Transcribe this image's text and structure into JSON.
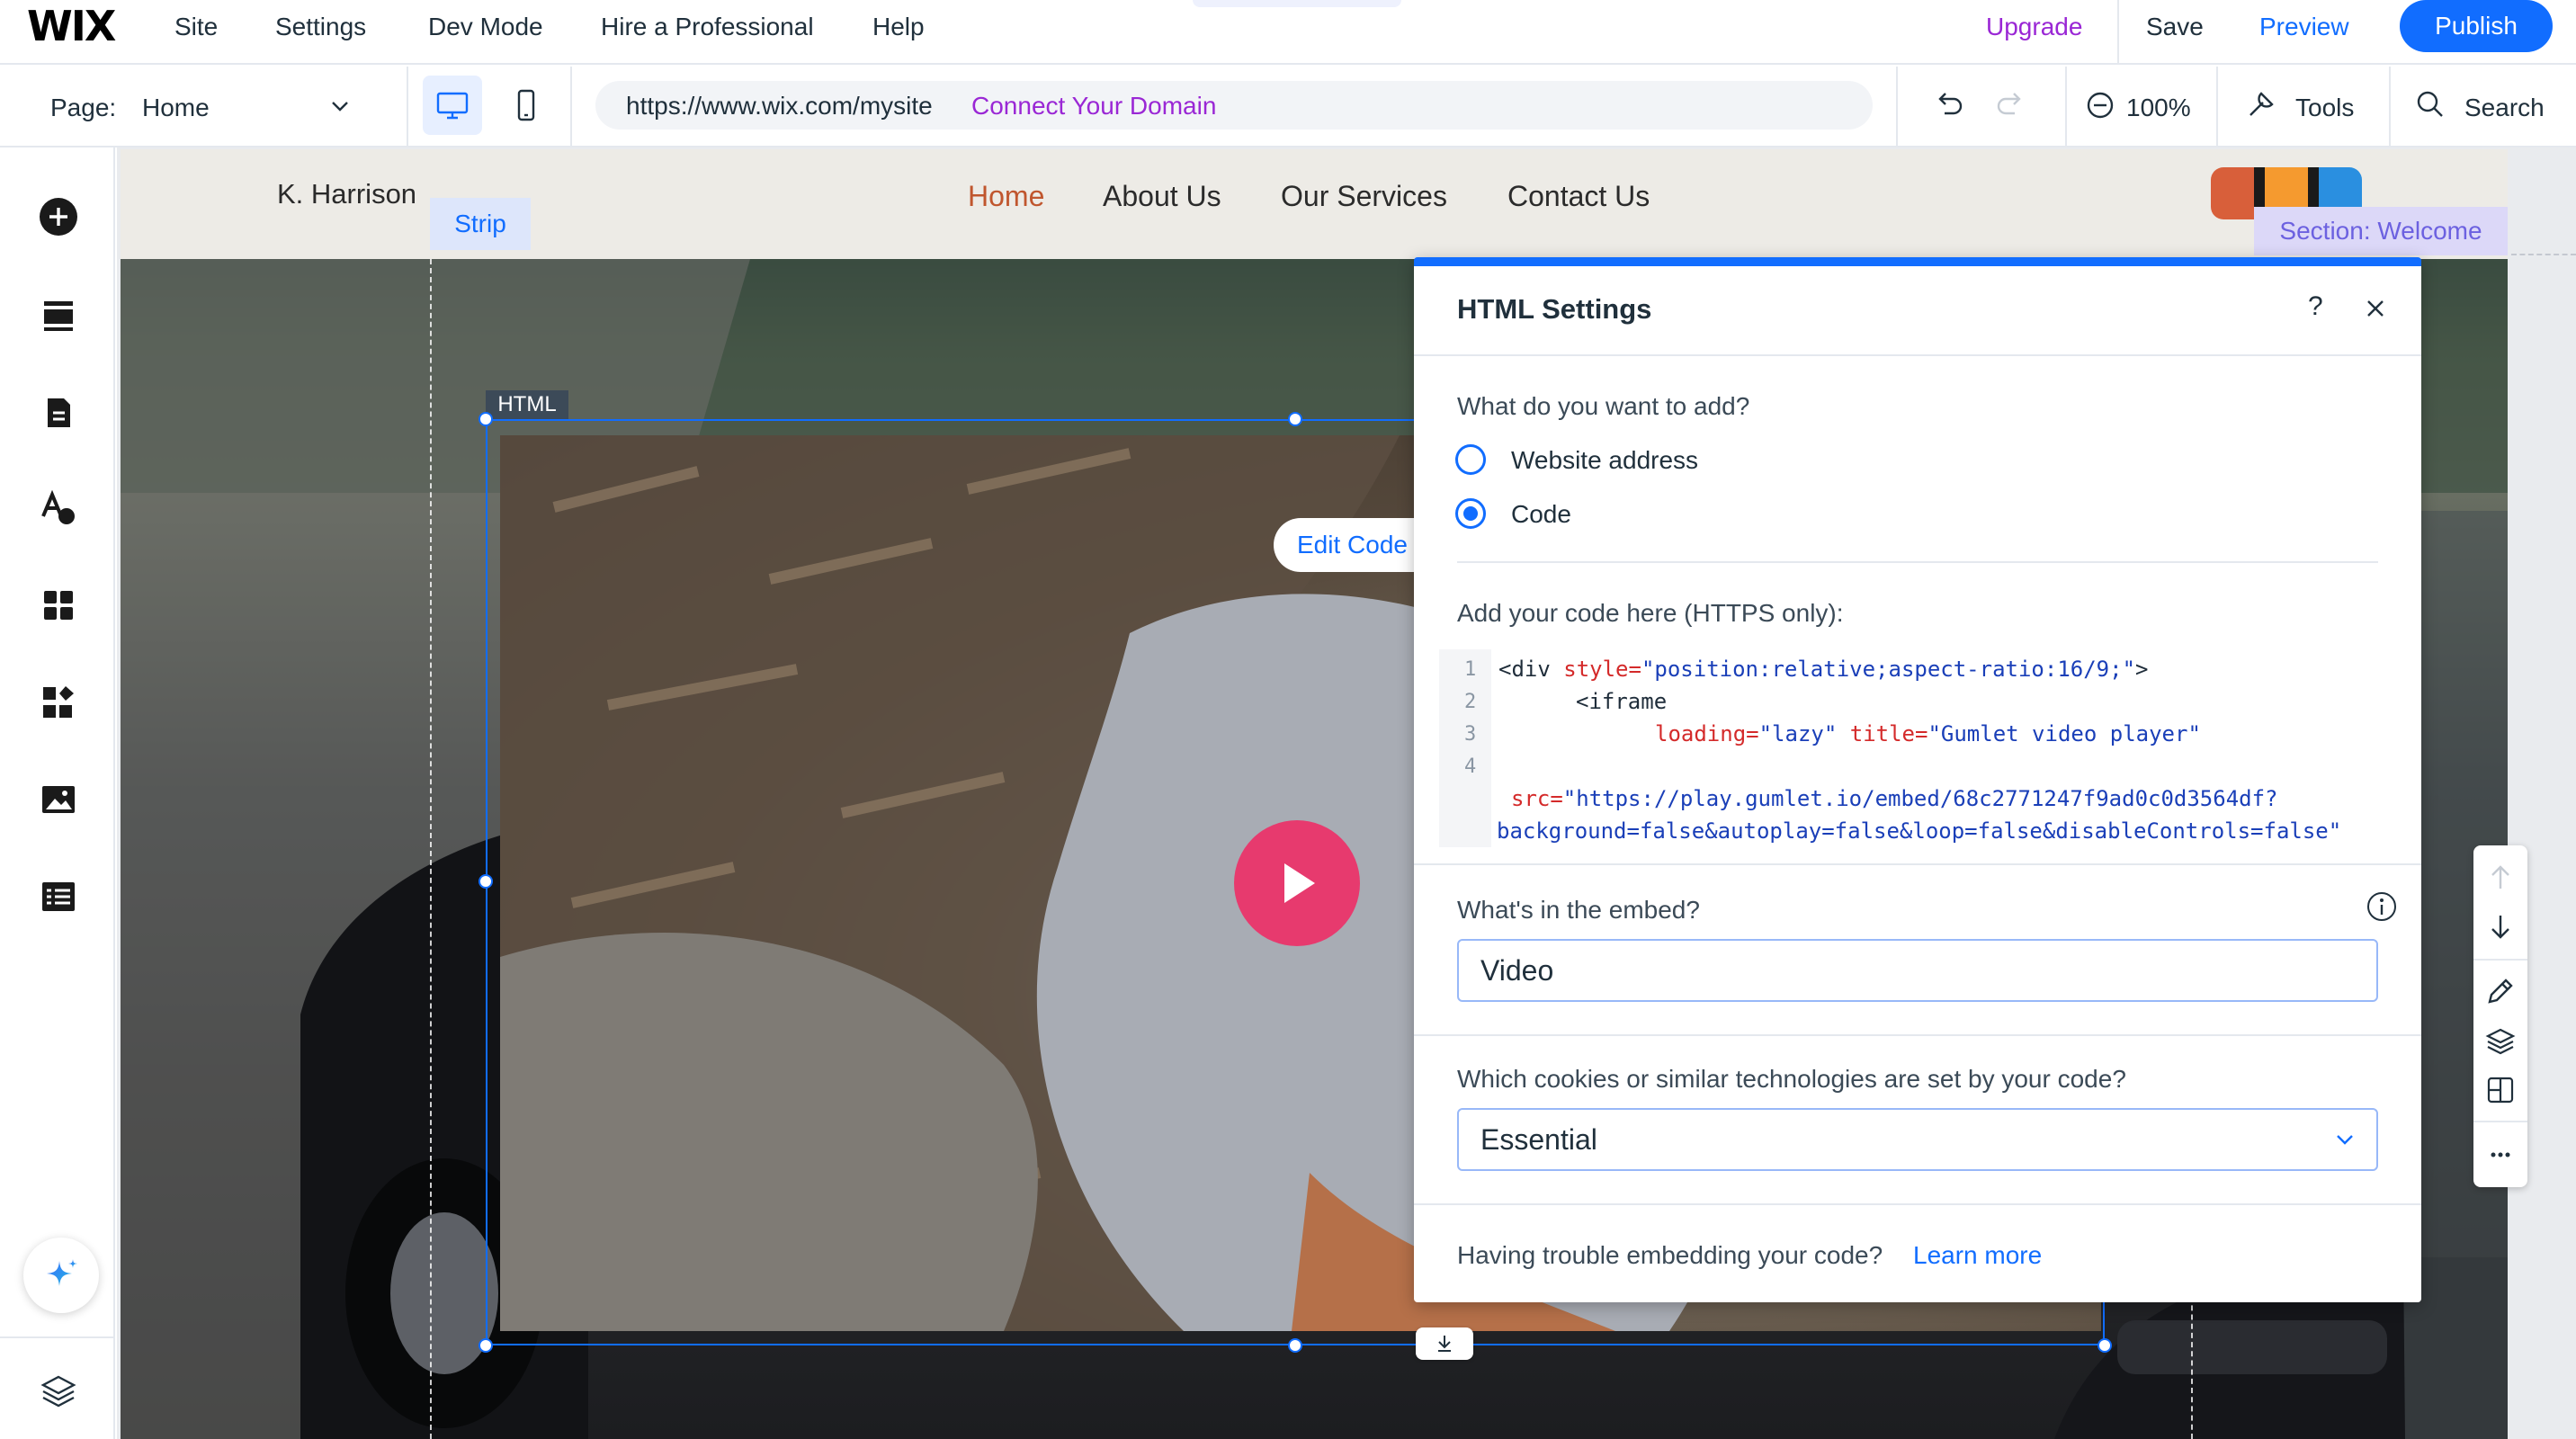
{
  "topbar": {
    "logo": "WIX",
    "menu": [
      "Site",
      "Settings",
      "Dev Mode",
      "Hire a Professional",
      "Help"
    ],
    "upgrade": "Upgrade",
    "save": "Save",
    "preview": "Preview",
    "publish": "Publish"
  },
  "secondbar": {
    "page_label": "Page:",
    "page_value": "Home",
    "url": "https://www.wix.com/mysite",
    "connect_domain": "Connect Your Domain",
    "zoom": "100%",
    "tools": "Tools",
    "search": "Search"
  },
  "sidebar": {
    "icons": [
      "add-icon",
      "sections-icon",
      "pages-icon",
      "design-icon",
      "apps-icon",
      "business-apps-icon",
      "media-icon",
      "cms-icon"
    ],
    "ai_icon": "sparkle-icon",
    "bottom_icon": "layers-icon"
  },
  "site": {
    "name": "K. Harrison",
    "strip_tag": "Strip",
    "nav": [
      "Home",
      "About Us",
      "Our Services",
      "Contact Us"
    ],
    "section_tag": "Section: Welcome",
    "social_colors": [
      "#d85f3a",
      "#f59a2f",
      "#2a8fe0"
    ],
    "accent_nav_color": "#c0562e"
  },
  "html_element": {
    "tag": "HTML",
    "edit_code": "Edit Code"
  },
  "panel": {
    "title": "HTML Settings",
    "help": "?",
    "question_add": "What do you want to add?",
    "options": [
      "Website address",
      "Code"
    ],
    "selected_option": "Code",
    "code_label": "Add your code here (HTTPS only):",
    "line_numbers": [
      "1",
      "2",
      "3",
      "4"
    ],
    "code": {
      "l1_open": "<div ",
      "l1_attr": "style=",
      "l1_str": "\"position:relative;aspect-ratio:16/9;\"",
      "l1_close": ">",
      "l2": "<iframe",
      "l3_attr1": "loading=",
      "l3_str1": "\"lazy\"",
      "l3_attr2": "title=",
      "l3_str2": "\"Gumlet video player\"",
      "l4_attr": "src=",
      "l4_str": "\"https://play.gumlet.io/embed/68c2771247f9ad0c0d3564df?",
      "l5_str": "background=false&autoplay=false&loop=false&disableControls=false\""
    },
    "question_embed": "What's in the embed?",
    "embed_value": "Video",
    "question_cookies": "Which cookies or similar technologies are set by your code?",
    "cookies_value": "Essential",
    "trouble_text": "Having trouble embedding your code?",
    "learn_more": "Learn more"
  },
  "colors": {
    "brand_blue": "#116dff",
    "upgrade_purple": "#9a27d5",
    "play_pink": "#e73a6e"
  }
}
